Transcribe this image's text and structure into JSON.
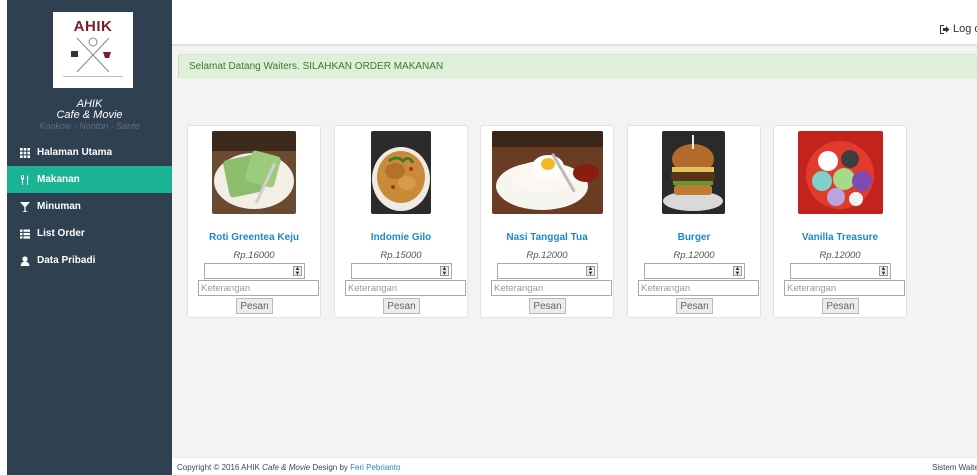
{
  "logo": {
    "text": "AHIK"
  },
  "brand": {
    "name_line1": "AHIK",
    "name_line2": "Cafe & Movie",
    "tagline": "Konkow - Nonton - Sante"
  },
  "nav": {
    "items": [
      {
        "label": "Halaman Utama",
        "icon": "grid-icon",
        "active": false
      },
      {
        "label": "Makanan",
        "icon": "cutlery-icon",
        "active": true
      },
      {
        "label": "Minuman",
        "icon": "glass-icon",
        "active": false
      },
      {
        "label": "List Order",
        "icon": "list-icon",
        "active": false
      },
      {
        "label": "Data Pribadi",
        "icon": "user-icon",
        "active": false
      }
    ]
  },
  "header": {
    "logout_label": "Log out"
  },
  "alert": {
    "message": "Selamat Datang Waiters. SILAHKAN ORDER MAKANAN"
  },
  "products": [
    {
      "name": "Roti Greentea Keju",
      "price": "Rp.16000",
      "note_placeholder": "Keterangan",
      "button": "Pesan"
    },
    {
      "name": "Indomie Gilo",
      "price": "Rp.15000",
      "note_placeholder": "Keterangan",
      "button": "Pesan"
    },
    {
      "name": "Nasi Tanggal Tua",
      "price": "Rp.12000",
      "note_placeholder": "Keterangan",
      "button": "Pesan"
    },
    {
      "name": "Burger",
      "price": "Rp.12000",
      "note_placeholder": "Keterangan",
      "button": "Pesan"
    },
    {
      "name": "Vanilla Treasure",
      "price": "Rp.12000",
      "note_placeholder": "Keterangan",
      "button": "Pesan"
    }
  ],
  "footer": {
    "copyright_prefix": "Copyright © 2016 AHIK",
    "brand_italic": "Cafe & Movie",
    "design_by": "Design by",
    "author": "Feri Pebrianto",
    "right_text": "Sistem Waiters"
  },
  "colors": {
    "sidebar": "#2f4050",
    "active": "#1ab394",
    "link": "#1e88c8",
    "alert_bg": "#dff0d8",
    "alert_text": "#3c763d"
  }
}
